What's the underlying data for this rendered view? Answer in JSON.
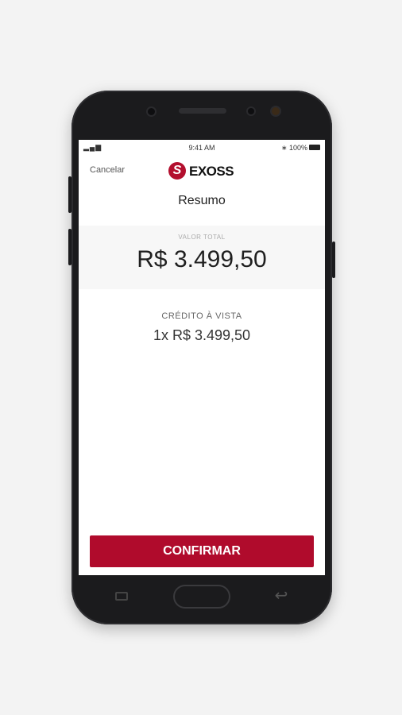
{
  "status_bar": {
    "signal": "▂▄▆",
    "time": "9:41 AM",
    "battery": "∗ 100%"
  },
  "header": {
    "cancel_label": "Cancelar",
    "logo_text": "EXOSS",
    "logo_mark": "S"
  },
  "page": {
    "title": "Resumo"
  },
  "summary": {
    "total_label": "VALOR TOTAL",
    "total_value": "R$ 3.499,50"
  },
  "payment": {
    "method_label": "CRÉDITO À VISTA",
    "installments": "1x  R$ 3.499,50"
  },
  "actions": {
    "confirm_label": "CONFIRMAR"
  },
  "colors": {
    "accent": "#b00b2c",
    "background": "#f3f3f3",
    "phone": "#1b1b1d"
  }
}
